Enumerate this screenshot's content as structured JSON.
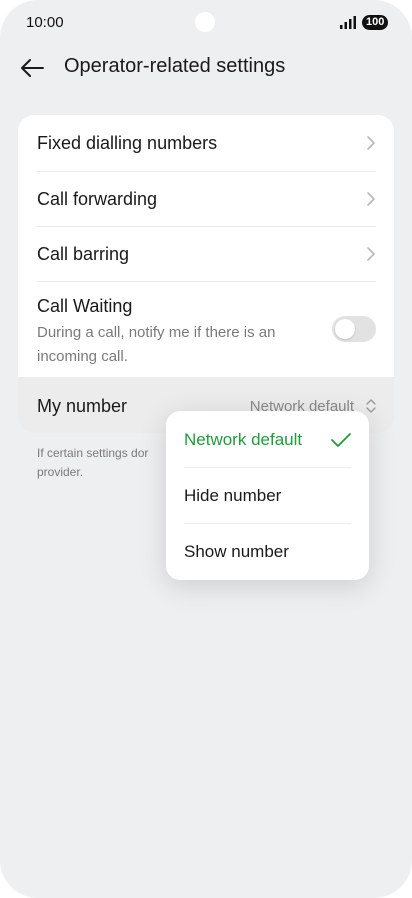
{
  "status_bar": {
    "time": "10:00",
    "battery": "100"
  },
  "header": {
    "title": "Operator-related settings"
  },
  "settings": {
    "fixed_dialling": "Fixed dialling numbers",
    "call_forwarding": "Call forwarding",
    "call_barring": "Call barring",
    "call_waiting": {
      "title": "Call Waiting",
      "description": "During a call, notify me if there is an incoming call.",
      "enabled": false
    },
    "my_number": {
      "label": "My number",
      "value": "Network default"
    }
  },
  "footnote": "If certain settings don’t work, contact your service provider.",
  "footnote_visible": "If certain settings dor",
  "footnote_line2": "provider.",
  "popup": {
    "options": [
      {
        "label": "Network default",
        "selected": true
      },
      {
        "label": "Hide number",
        "selected": false
      },
      {
        "label": "Show number",
        "selected": false
      }
    ]
  },
  "colors": {
    "accent": "#1f9d3a",
    "background": "#eeeff1",
    "card": "#ffffff"
  },
  "icons": {
    "back": "arrow-left-icon",
    "chevron": "chevron-right-icon",
    "check": "check-icon",
    "updown": "chevron-up-down-icon",
    "signal": "signal-icon",
    "battery": "battery-icon"
  }
}
